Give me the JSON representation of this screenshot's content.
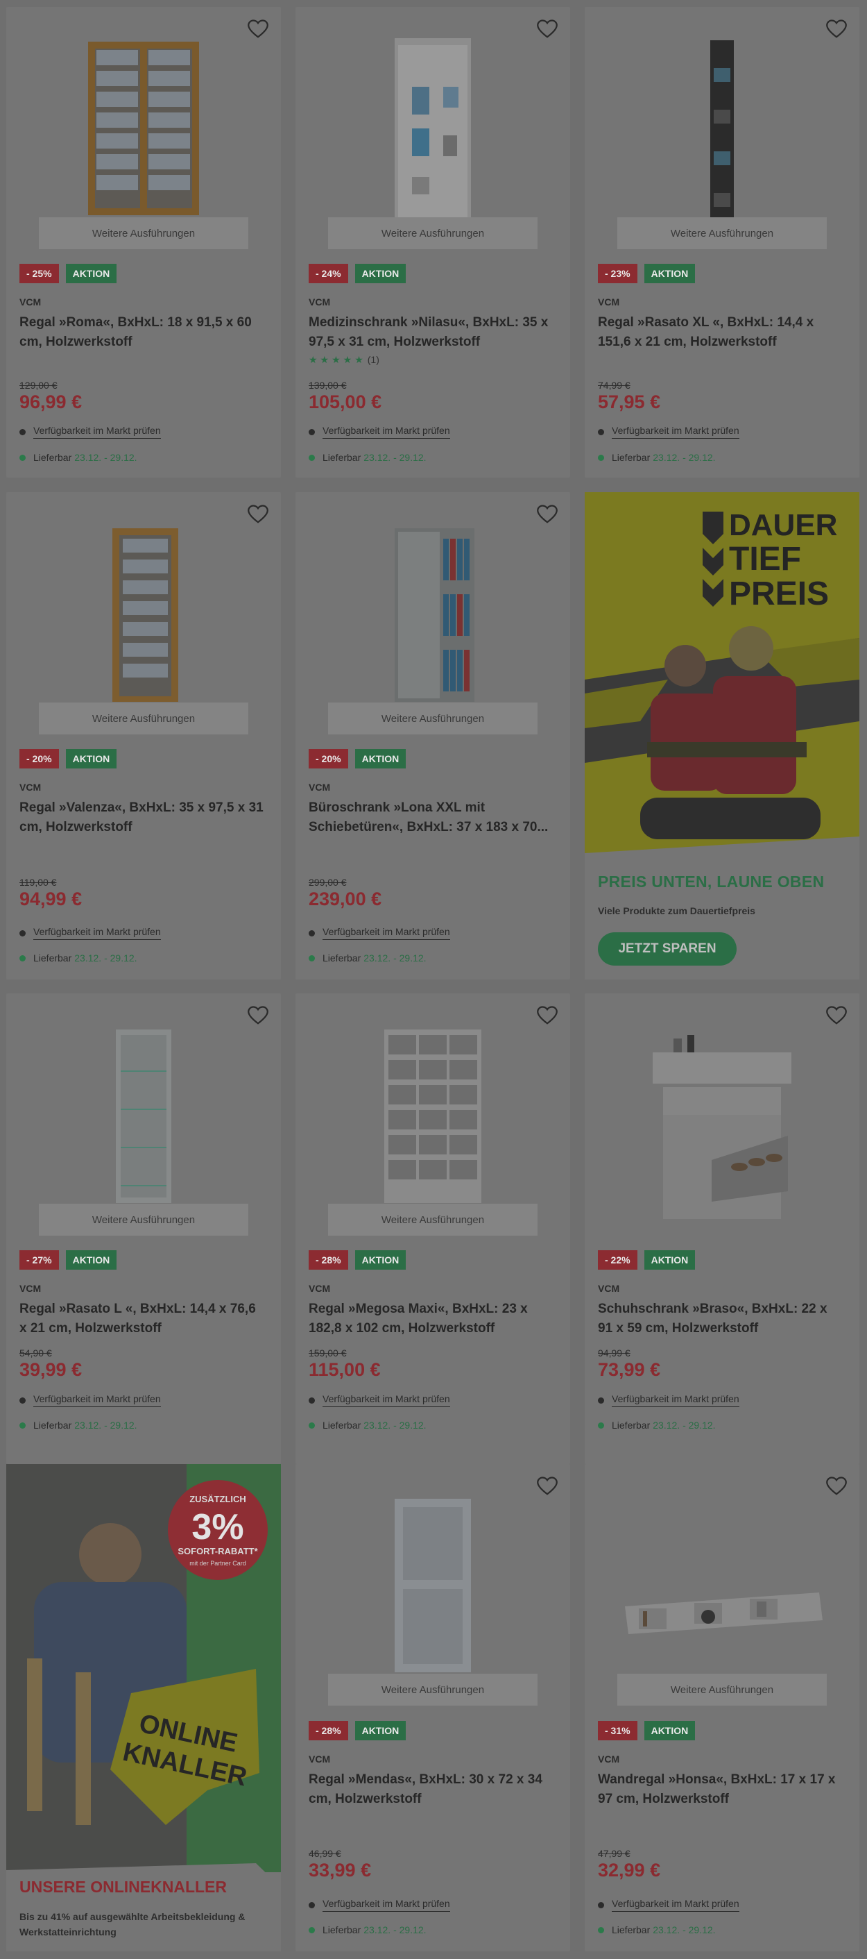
{
  "common": {
    "more_variants": "Weitere Ausführungen",
    "akt_label": "AKTION",
    "availability_label": "Verfügbarkeit im Markt prüfen",
    "delivery_label": "Lieferbar",
    "delivery_dates": "23.12. - 29.12."
  },
  "products": [
    {
      "discount": "- 25%",
      "brand": "VCM",
      "title": "Regal »Roma«, BxHxL: 18 x 91,5 x 60 cm, Holzwerkstoff",
      "old_price": "129,00 €",
      "price": "96,99 €"
    },
    {
      "discount": "- 24%",
      "brand": "VCM",
      "title": "Medizinschrank »Nilasu«, BxHxL: 35 x 97,5 x 31 cm, Holzwerkstoff",
      "rating": "★★★★★",
      "rating_count": "(1)",
      "old_price": "139,00 €",
      "price": "105,00 €"
    },
    {
      "discount": "- 23%",
      "brand": "VCM",
      "title": "Regal »Rasato XL «, BxHxL: 14,4 x 151,6 x 21 cm, Holzwerkstoff",
      "old_price": "74,99 €",
      "price": "57,95 €"
    },
    {
      "discount": "- 20%",
      "brand": "VCM",
      "title": "Regal »Valenza«, BxHxL: 35 x 97,5 x 31 cm, Holzwerkstoff",
      "old_price": "119,00 €",
      "price": "94,99 €"
    },
    {
      "discount": "- 20%",
      "brand": "VCM",
      "title": "Büroschrank »Lona XXL mit Schiebetüren«, BxHxL: 37 x 183 x 70...",
      "old_price": "299,00 €",
      "price": "239,00 €"
    },
    {
      "discount": "- 27%",
      "brand": "VCM",
      "title": "Regal »Rasato L «, BxHxL: 14,4 x 76,6 x 21 cm, Holzwerkstoff",
      "old_price": "54,90 €",
      "price": "39,99 €"
    },
    {
      "discount": "- 28%",
      "brand": "VCM",
      "title": "Regal »Megosa Maxi«, BxHxL: 23 x 182,8 x 102 cm, Holzwerkstoff",
      "old_price": "159,00 €",
      "price": "115,00 €"
    },
    {
      "discount": "- 22%",
      "brand": "VCM",
      "title": "Schuhschrank »Braso«, BxHxL: 22 x 91 x 59 cm, Holzwerkstoff",
      "old_price": "94,99 €",
      "price": "73,99 €"
    },
    {
      "discount": "- 28%",
      "brand": "VCM",
      "title": "Regal »Mendas«, BxHxL: 30 x 72 x 34 cm, Holzwerkstoff",
      "old_price": "46,99 €",
      "price": "33,99 €"
    },
    {
      "discount": "- 31%",
      "brand": "VCM",
      "title": "Wandregal »Honsa«, BxHxL: 17 x 17 x 97 cm, Holzwerkstoff",
      "old_price": "47,99 €",
      "price": "32,99 €"
    }
  ],
  "promo_dauertiefpreis": {
    "logo_line1": "DAUER",
    "logo_line2": "TIEF",
    "logo_line3": "PREIS",
    "claim": "PREIS UNTEN, LAUNE OBEN",
    "subtitle": "Viele Produkte zum Dauertiefpreis",
    "button": "JETZT SPAREN"
  },
  "promo_onlineknaller": {
    "sticker_top": "ZUSÄTZLICH",
    "sticker_value": "3%",
    "sticker_label": "SOFORT-RABATT*",
    "sticker_note": "mit der Partner Card",
    "badge_line1": "ONLINE",
    "badge_line2": "KNALLER",
    "claim": "UNSERE ONLINEKNALLER",
    "subtitle": "Bis zu 41% auf ausgewählte Arbeitsbekleidung & Werkstatteinrichtung"
  },
  "colors": {
    "discount_red": "#8c2b31",
    "aktion_green": "#2b6e46",
    "price_red": "#8b2a30",
    "overlay_grey": "#757575"
  }
}
